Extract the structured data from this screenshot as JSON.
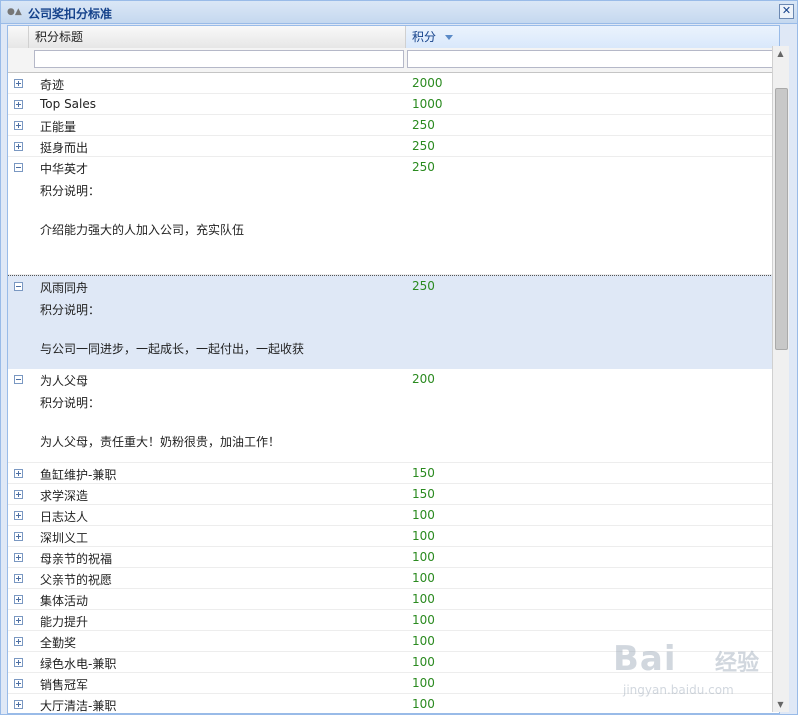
{
  "window": {
    "title": "公司奖扣分标准",
    "close_glyph": "✕"
  },
  "columns": {
    "title": "积分标题",
    "score": "积分"
  },
  "filters": {
    "title_value": "",
    "score_value": ""
  },
  "rows": [
    {
      "title": "奇迹",
      "score": "2000",
      "expanded": false
    },
    {
      "title": "Top Sales",
      "score": "1000",
      "expanded": false
    },
    {
      "title": "正能量",
      "score": "250",
      "expanded": false
    },
    {
      "title": "挺身而出",
      "score": "250",
      "expanded": false
    },
    {
      "title": "中华英才",
      "score": "250",
      "expanded": true,
      "desc_label": "积分说明：",
      "desc": "介绍能力强大的人加入公司，充实队伍"
    },
    {
      "title": "风雨同舟",
      "score": "250",
      "expanded": true,
      "selected": true,
      "desc_label": "积分说明：",
      "desc": "与公司一同进步，一起成长，一起付出，一起收获"
    },
    {
      "title": "为人父母",
      "score": "200",
      "expanded": true,
      "desc_label": "积分说明：",
      "desc": "为人父母，责任重大！奶粉很贵，加油工作！"
    },
    {
      "title": "鱼缸维护-兼职",
      "score": "150",
      "expanded": false
    },
    {
      "title": "求学深造",
      "score": "150",
      "expanded": false
    },
    {
      "title": "日志达人",
      "score": "100",
      "expanded": false
    },
    {
      "title": "深圳义工",
      "score": "100",
      "expanded": false
    },
    {
      "title": "母亲节的祝福",
      "score": "100",
      "expanded": false
    },
    {
      "title": "父亲节的祝愿",
      "score": "100",
      "expanded": false
    },
    {
      "title": "集体活动",
      "score": "100",
      "expanded": false
    },
    {
      "title": "能力提升",
      "score": "100",
      "expanded": false
    },
    {
      "title": "全勤奖",
      "score": "100",
      "expanded": false
    },
    {
      "title": "绿色水电-兼职",
      "score": "100",
      "expanded": false
    },
    {
      "title": "销售冠军",
      "score": "100",
      "expanded": false
    },
    {
      "title": "大厅清洁-兼职",
      "score": "100",
      "expanded": false
    }
  ],
  "watermark": {
    "brand": "Bai",
    "cn": "经验",
    "url": "jingyan.baidu.com"
  },
  "colors": {
    "score": "#2a8a1f",
    "title": "#15428b",
    "selected_row": "#dfe8f6"
  }
}
